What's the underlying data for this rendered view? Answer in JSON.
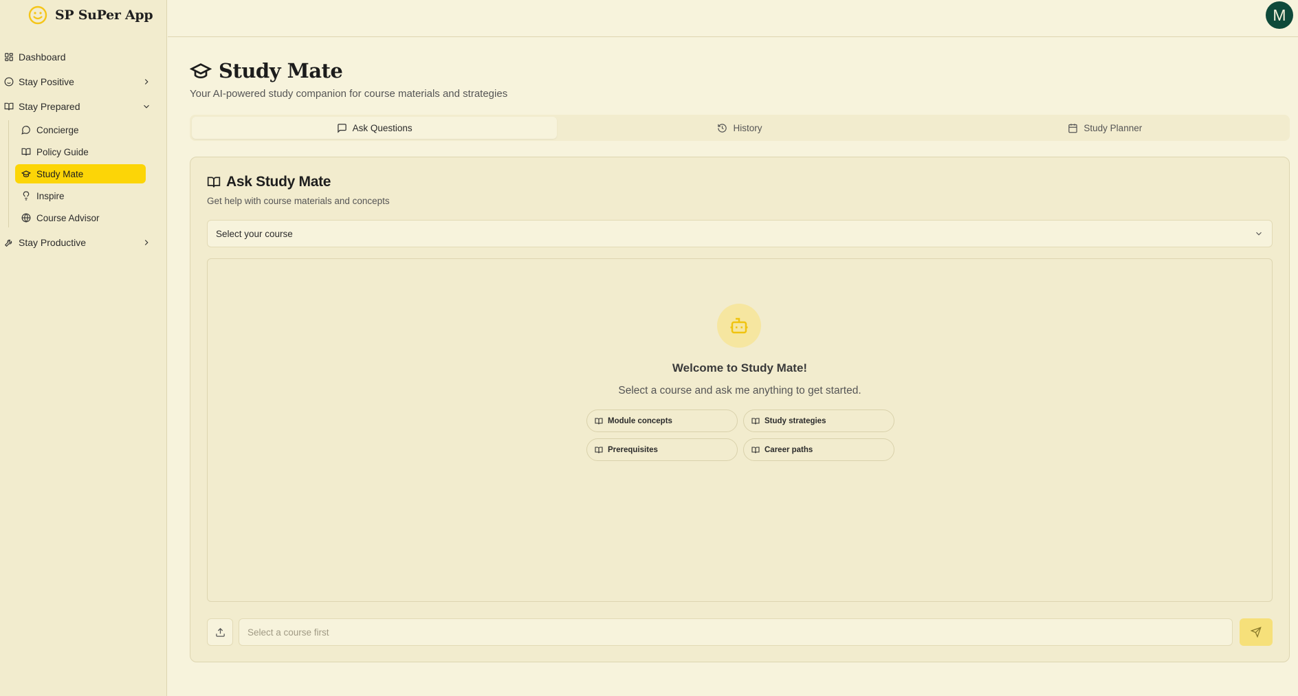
{
  "app": {
    "brand": "SP SuPer App",
    "accent": "#fcd507",
    "avatar_letter": "M",
    "avatar_color": "#0f4a3a"
  },
  "sidebar": {
    "items": [
      {
        "label": "Dashboard",
        "icon": "dashboard-grid-icon"
      },
      {
        "label": "Stay Positive",
        "icon": "smile-icon",
        "chevron": "right"
      },
      {
        "label": "Stay Prepared",
        "icon": "book-open-icon",
        "chevron": "down"
      },
      {
        "label": "Stay Productive",
        "icon": "wrench-icon",
        "chevron": "right"
      }
    ],
    "sub_items": [
      {
        "label": "Concierge",
        "icon": "chat-bubble-icon"
      },
      {
        "label": "Policy Guide",
        "icon": "book-open-icon"
      },
      {
        "label": "Study Mate",
        "icon": "graduation-cap-icon",
        "active": true
      },
      {
        "label": "Inspire",
        "icon": "lightbulb-icon"
      },
      {
        "label": "Course Advisor",
        "icon": "globe-icon"
      }
    ]
  },
  "page": {
    "title": "Study Mate",
    "subtitle": "Your AI-powered study companion for course materials and strategies"
  },
  "tabs": [
    {
      "label": "Ask Questions",
      "icon": "message-square-icon",
      "active": true
    },
    {
      "label": "History",
      "icon": "history-icon"
    },
    {
      "label": "Study Planner",
      "icon": "calendar-icon"
    }
  ],
  "card": {
    "title": "Ask Study Mate",
    "description": "Get help with course materials and concepts",
    "course_select": "Select your course",
    "welcome_title": "Welcome to Study Mate!",
    "welcome_text": "Select a course and ask me anything to get started.",
    "chips": [
      "Module concepts",
      "Study strategies",
      "Prerequisites",
      "Career paths"
    ],
    "input_placeholder": "Select a course first"
  }
}
